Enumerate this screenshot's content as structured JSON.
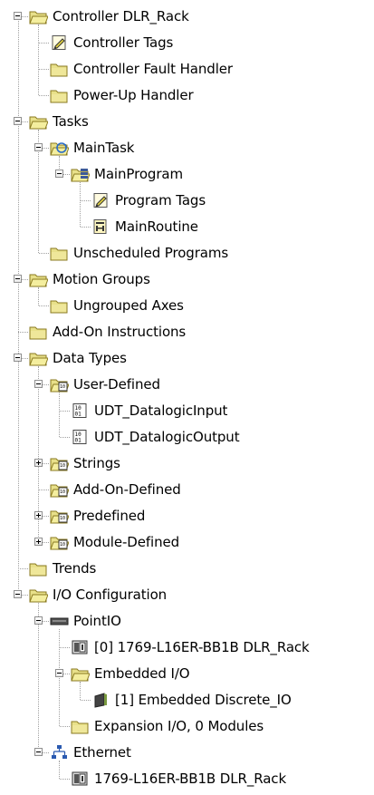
{
  "tree": {
    "items": [
      {
        "label": "Controller DLR_Rack",
        "depth": 0,
        "icon": "folder-open-icon",
        "toggle": "minus"
      },
      {
        "label": "Controller Tags",
        "depth": 1,
        "icon": "tags-icon",
        "toggle": null
      },
      {
        "label": "Controller Fault Handler",
        "depth": 1,
        "icon": "folder-icon",
        "toggle": null
      },
      {
        "label": "Power-Up Handler",
        "depth": 1,
        "icon": "folder-icon",
        "toggle": null
      },
      {
        "label": "Tasks",
        "depth": 0,
        "icon": "folder-open-icon",
        "toggle": "minus"
      },
      {
        "label": "MainTask",
        "depth": 1,
        "icon": "task-icon",
        "toggle": "minus"
      },
      {
        "label": "MainProgram",
        "depth": 2,
        "icon": "program-icon",
        "toggle": "minus"
      },
      {
        "label": "Program Tags",
        "depth": 3,
        "icon": "tags-icon",
        "toggle": null
      },
      {
        "label": "MainRoutine",
        "depth": 3,
        "icon": "routine-icon",
        "toggle": null
      },
      {
        "label": "Unscheduled Programs",
        "depth": 1,
        "icon": "folder-icon",
        "toggle": null
      },
      {
        "label": "Motion Groups",
        "depth": 0,
        "icon": "folder-open-icon",
        "toggle": "minus"
      },
      {
        "label": "Ungrouped Axes",
        "depth": 1,
        "icon": "folder-icon",
        "toggle": null
      },
      {
        "label": "Add-On Instructions",
        "depth": 0,
        "icon": "folder-icon",
        "toggle": null
      },
      {
        "label": "Data Types",
        "depth": 0,
        "icon": "folder-open-icon",
        "toggle": "minus"
      },
      {
        "label": "User-Defined",
        "depth": 1,
        "icon": "datatype-folder-icon",
        "toggle": "minus"
      },
      {
        "label": "UDT_DatalogicInput",
        "depth": 2,
        "icon": "datatype-icon",
        "toggle": null
      },
      {
        "label": "UDT_DatalogicOutput",
        "depth": 2,
        "icon": "datatype-icon",
        "toggle": null
      },
      {
        "label": "Strings",
        "depth": 1,
        "icon": "datatype-folder-icon",
        "toggle": "plus"
      },
      {
        "label": "Add-On-Defined",
        "depth": 1,
        "icon": "datatype-folder-icon",
        "toggle": null
      },
      {
        "label": "Predefined",
        "depth": 1,
        "icon": "datatype-folder-icon",
        "toggle": "plus"
      },
      {
        "label": "Module-Defined",
        "depth": 1,
        "icon": "datatype-folder-icon",
        "toggle": "plus"
      },
      {
        "label": "Trends",
        "depth": 0,
        "icon": "folder-icon",
        "toggle": null
      },
      {
        "label": "I/O Configuration",
        "depth": 0,
        "icon": "folder-open-icon",
        "toggle": "minus"
      },
      {
        "label": "PointIO",
        "depth": 1,
        "icon": "backplane-icon",
        "toggle": "minus"
      },
      {
        "label": "[0] 1769-L16ER-BB1B DLR_Rack",
        "depth": 2,
        "icon": "module-icon",
        "toggle": null
      },
      {
        "label": "Embedded I/O",
        "depth": 2,
        "icon": "folder-open-icon",
        "toggle": "minus"
      },
      {
        "label": "[1] Embedded Discrete_IO",
        "depth": 3,
        "icon": "discrete-io-icon",
        "toggle": null
      },
      {
        "label": "Expansion I/O, 0 Modules",
        "depth": 2,
        "icon": "folder-icon",
        "toggle": null
      },
      {
        "label": "Ethernet",
        "depth": 1,
        "icon": "ethernet-icon",
        "toggle": "minus"
      },
      {
        "label": "1769-L16ER-BB1B DLR_Rack",
        "depth": 2,
        "icon": "module-icon",
        "toggle": null
      }
    ]
  },
  "colors": {
    "folder_fill": "#e8e08a",
    "folder_stroke": "#8a7a20",
    "tree_line": "#a0a0a0"
  }
}
